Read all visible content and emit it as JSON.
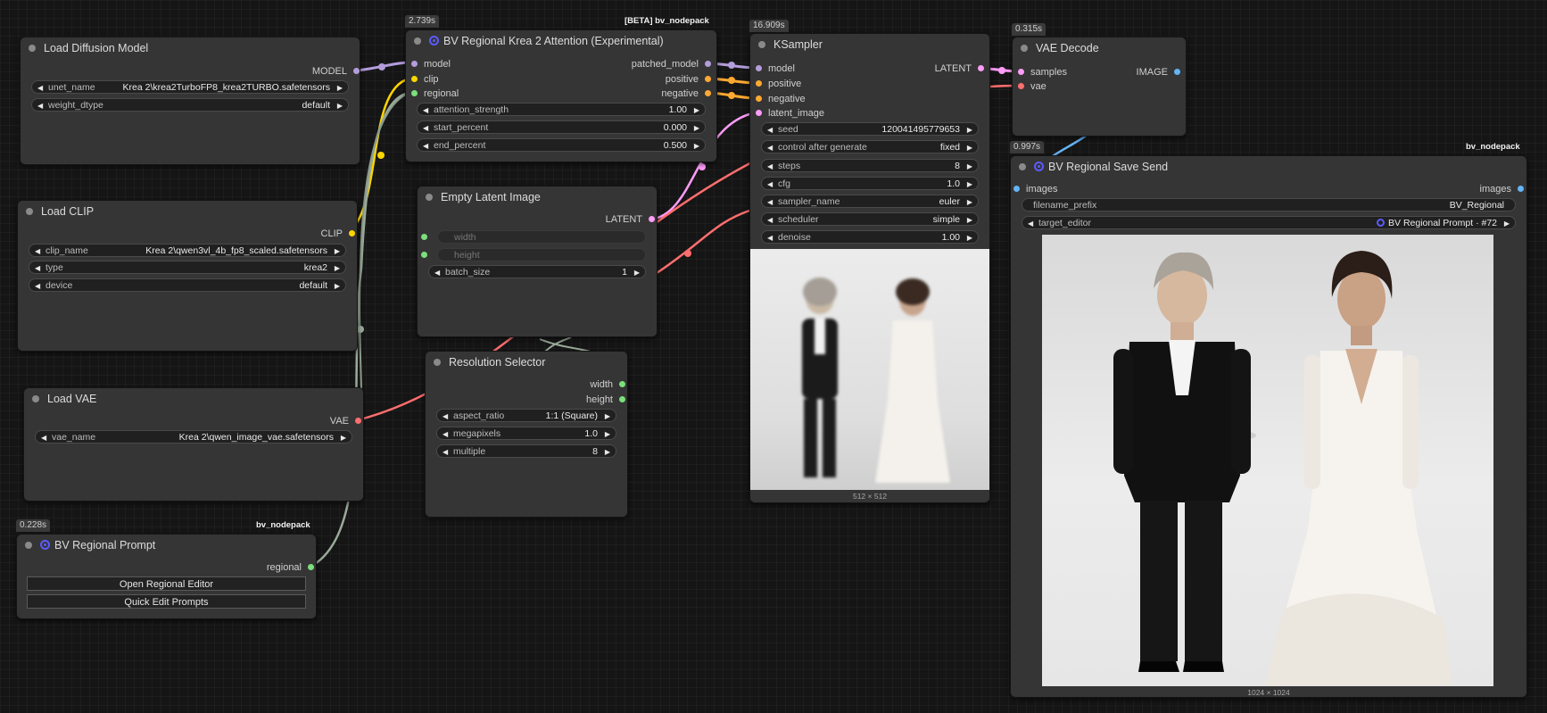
{
  "colors": {
    "model": "#b39ddb",
    "clip": "#ffd500",
    "regional": "#7be07b",
    "conditioning": "#ffa931",
    "latent": "#ff9cf9",
    "vae": "#ff6e6e",
    "image": "#64b5f6",
    "gray_wire": "#9aaa9a",
    "canvas": "#151515",
    "node": "#353535",
    "accent_spiral": "#5b5bff"
  },
  "nodes": {
    "load_diffusion_model": {
      "title": "Load Diffusion Model",
      "outputs": [
        "MODEL"
      ],
      "widgets": [
        {
          "label": "unet_name",
          "value": "Krea 2\\krea2TurboFP8_krea2TURBO.safetensors"
        },
        {
          "label": "weight_dtype",
          "value": "default"
        }
      ]
    },
    "krea_attention": {
      "time": "2.739s",
      "tag": "[BETA] bv_nodepack",
      "icon": "spiral-icon",
      "title": "BV Regional Krea 2 Attention (Experimental)",
      "inputs": [
        "model",
        "clip",
        "regional"
      ],
      "outputs": [
        "patched_model",
        "positive",
        "negative"
      ],
      "widgets": [
        {
          "label": "attention_strength",
          "value": "1.00"
        },
        {
          "label": "start_percent",
          "value": "0.000"
        },
        {
          "label": "end_percent",
          "value": "0.500"
        }
      ]
    },
    "ksampler": {
      "time": "16.909s",
      "title": "KSampler",
      "inputs": [
        "model",
        "positive",
        "negative",
        "latent_image"
      ],
      "outputs": [
        "LATENT"
      ],
      "widgets": [
        {
          "label": "seed",
          "value": "120041495779653"
        },
        {
          "label": "control after generate",
          "value": "fixed"
        },
        {
          "label": "steps",
          "value": "8"
        },
        {
          "label": "cfg",
          "value": "1.0"
        },
        {
          "label": "sampler_name",
          "value": "euler"
        },
        {
          "label": "scheduler",
          "value": "simple"
        },
        {
          "label": "denoise",
          "value": "1.00"
        }
      ],
      "preview_size": "512 × 512"
    },
    "vae_decode": {
      "time": "0.315s",
      "title": "VAE Decode",
      "inputs": [
        "samples",
        "vae"
      ],
      "outputs": [
        "IMAGE"
      ]
    },
    "load_clip": {
      "title": "Load CLIP",
      "outputs": [
        "CLIP"
      ],
      "widgets": [
        {
          "label": "clip_name",
          "value": "Krea 2\\qwen3vl_4b_fp8_scaled.safetensors"
        },
        {
          "label": "type",
          "value": "krea2"
        },
        {
          "label": "device",
          "value": "default"
        }
      ]
    },
    "empty_latent": {
      "title": "Empty Latent Image",
      "outputs": [
        "LATENT"
      ],
      "inputs": [
        "width",
        "height"
      ],
      "widgets": [
        {
          "label": "batch_size",
          "value": "1"
        }
      ]
    },
    "resolution_selector": {
      "title": "Resolution Selector",
      "outputs": [
        "width",
        "height"
      ],
      "widgets": [
        {
          "label": "aspect_ratio",
          "value": "1:1 (Square)"
        },
        {
          "label": "megapixels",
          "value": "1.0"
        },
        {
          "label": "multiple",
          "value": "8"
        }
      ]
    },
    "load_vae": {
      "title": "Load VAE",
      "outputs": [
        "VAE"
      ],
      "widgets": [
        {
          "label": "vae_name",
          "value": "Krea 2\\qwen_image_vae.safetensors"
        }
      ]
    },
    "regional_prompt": {
      "time": "0.228s",
      "tag": "bv_nodepack",
      "icon": "spiral-icon",
      "title": "BV Regional Prompt",
      "outputs": [
        "regional"
      ],
      "buttons": [
        "Open Regional Editor",
        "Quick Edit Prompts"
      ]
    },
    "save_send": {
      "time": "0.997s",
      "tag": "bv_nodepack",
      "icon": "spiral-icon",
      "title": "BV Regional Save Send",
      "inputs": [
        "images"
      ],
      "outputs": [
        "images"
      ],
      "widgets": [
        {
          "label": "filename_prefix",
          "value": "BV_Regional"
        },
        {
          "label": "target_editor",
          "value": "BV Regional Prompt · #72"
        }
      ],
      "preview_size": "1024 × 1024"
    }
  }
}
